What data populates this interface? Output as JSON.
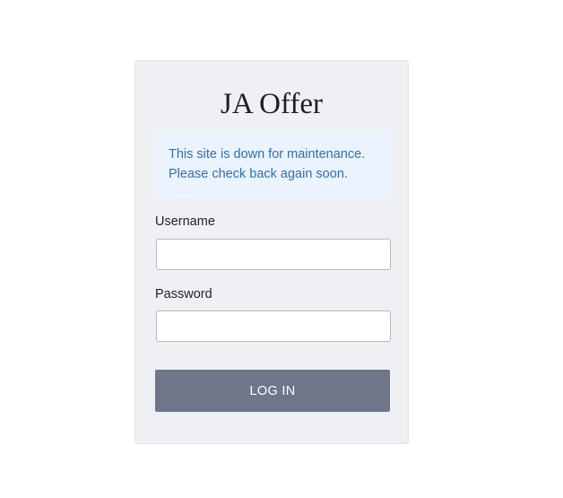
{
  "site": {
    "title": "JA Offer"
  },
  "notice": {
    "line1": "This site is down for maintenance.",
    "line2": "Please check back again soon."
  },
  "form": {
    "username_label": "Username",
    "username_value": "",
    "password_label": "Password",
    "password_value": "",
    "submit_label": "LOG IN"
  },
  "colors": {
    "card_background": "#eff0f4",
    "notice_background": "#ebf3fe",
    "notice_text": "#2f6fb0",
    "button_background": "#707689"
  }
}
